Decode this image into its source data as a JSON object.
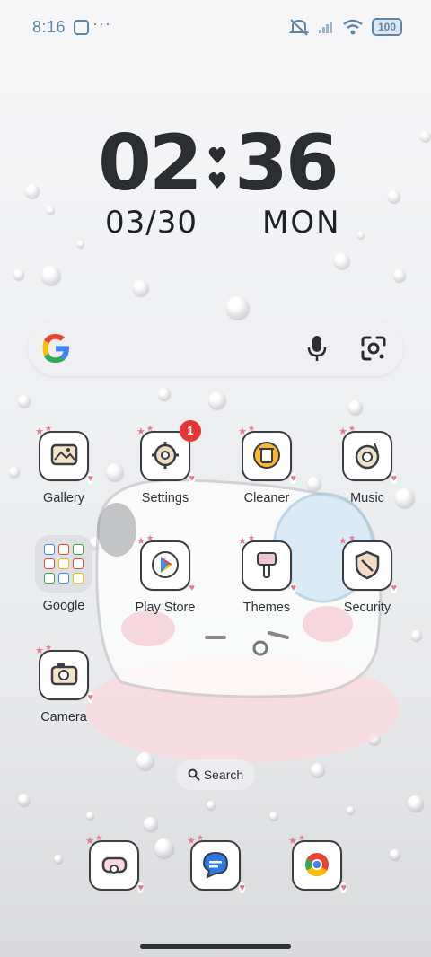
{
  "status_bar": {
    "time": "8:16",
    "dots": "···",
    "battery": "100",
    "icons": [
      "sync-icon",
      "mute-icon",
      "signal-icon",
      "wifi-icon",
      "battery-icon"
    ]
  },
  "clock": {
    "hours": "02",
    "minutes": "36",
    "date": "03/30",
    "day": "MON"
  },
  "google_widget": {
    "icons": [
      "google-logo-icon",
      "mic-icon",
      "lens-icon"
    ]
  },
  "apps": [
    {
      "label": "Gallery",
      "icon": "gallery-icon"
    },
    {
      "label": "Settings",
      "icon": "gear-icon",
      "badge": "1"
    },
    {
      "label": "Cleaner",
      "icon": "trash-icon"
    },
    {
      "label": "Music",
      "icon": "vinyl-icon"
    },
    {
      "label": "Google",
      "icon": "folder-icon"
    },
    {
      "label": "Play Store",
      "icon": "play-store-icon"
    },
    {
      "label": "Themes",
      "icon": "brush-icon"
    },
    {
      "label": "Security",
      "icon": "shield-icon"
    },
    {
      "label": "Camera",
      "icon": "camera-icon"
    }
  ],
  "search_pill": {
    "label": "Search"
  },
  "dock": [
    {
      "icon": "phone-icon"
    },
    {
      "icon": "messages-icon"
    },
    {
      "icon": "chrome-icon"
    }
  ],
  "colors": {
    "accent_status": "#5e86a9",
    "badge": "#e53535",
    "heart": "#e07b94"
  }
}
